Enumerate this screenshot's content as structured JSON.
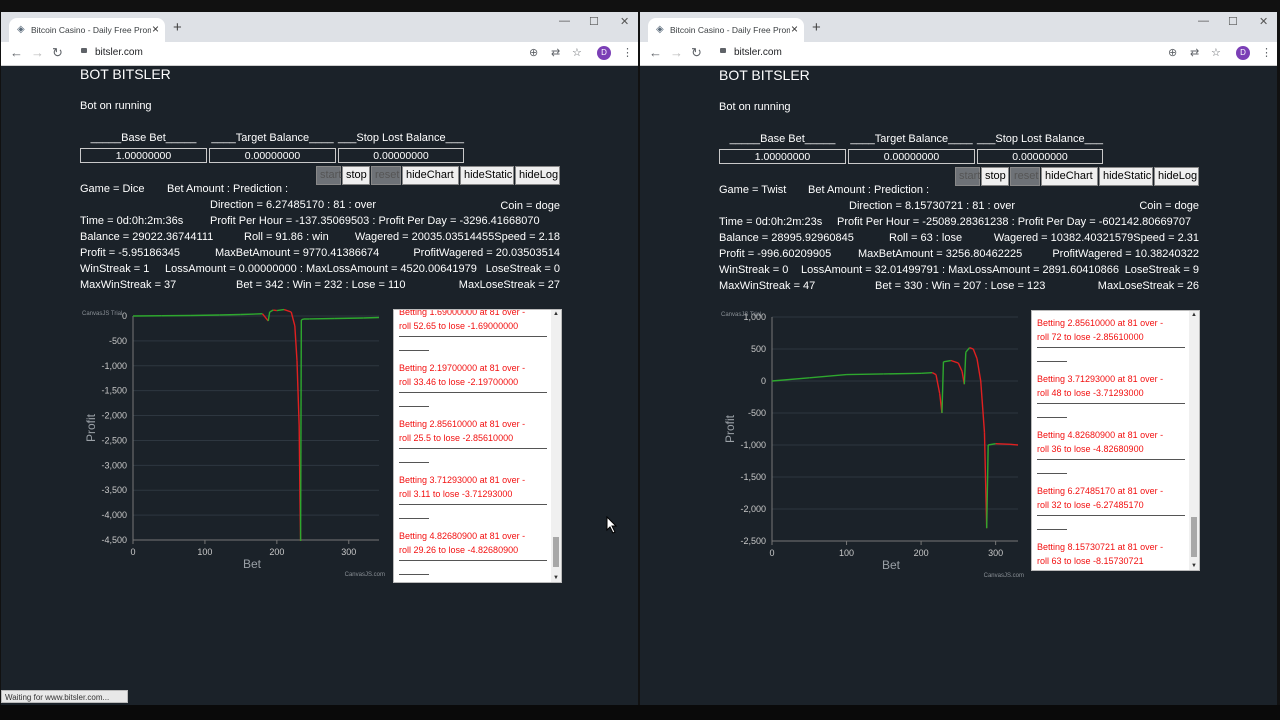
{
  "left": {
    "tab_title": "Bitcoin Casino - Daily Free Promo",
    "url": "bitsler.com",
    "avatar": "D",
    "bot_title": "BOT BITSLER",
    "bot_status": "Bot on running",
    "labels": {
      "base_bet": "_____Base Bet_____",
      "target_balance": "____Target Balance____",
      "stop_lost": "___Stop Lost Balance___"
    },
    "inputs": {
      "base_bet": "1.00000000",
      "target_balance": "0.00000000",
      "stop_lost": "0.00000000"
    },
    "buttons": {
      "start": "start",
      "stop": "stop",
      "reset": "reset",
      "hide_chart": "hideChart",
      "hide_static": "hideStatic",
      "hide_log": "hideLog"
    },
    "stats": {
      "game": "Game = Dice",
      "bet_amount": "Bet Amount : Prediction :",
      "direction": "Direction = 6.27485170 : 81 : over",
      "coin": "Coin = doge",
      "time": "Time = 0d:0h:2m:36s",
      "profit_rate": "Profit Per Hour = -137.35069503 : Profit Per Day = -3296.41668070",
      "balance": "Balance = 29022.36744111",
      "roll": "Roll = 91.86 : win",
      "wagered": "Wagered = 20035.03514455Speed = 2.18",
      "profit": "Profit = -5.95186345",
      "max_bet": "MaxBetAmount = 9770.41386674",
      "profit_wagered": "ProfitWagered = 20.03503514",
      "win_streak": "WinStreak = 1",
      "loss_amount": "LossAmount = 0.00000000 : MaxLossAmount = 4520.00641979",
      "lose_streak": "LoseStreak = 0",
      "max_win_streak": "MaxWinStreak = 37",
      "bet_count": "Bet = 342 : Win = 232 : Lose = 110",
      "max_lose_streak": "MaxLoseStreak = 27"
    },
    "chart_data": {
      "type": "line",
      "xlabel": "Bet",
      "ylabel": "Profit",
      "credit_top": "CanvasJS Trial",
      "credit_bottom": "CanvasJS.com",
      "xlim": [
        0,
        342
      ],
      "ylim": [
        -4500,
        0
      ],
      "xticks": [
        0,
        100,
        200,
        300
      ],
      "yticks": [
        0,
        -500,
        -1000,
        -1500,
        -2000,
        -2500,
        -3000,
        -3500,
        -4000,
        -4500
      ],
      "ytick_labels": [
        "0",
        "-500",
        "-1,000",
        "-1,500",
        "-2,000",
        "-2,500",
        "-3,000",
        "-3,500",
        "-4,000",
        "-4,500"
      ],
      "series": [
        {
          "x": [
            0,
            40,
            80,
            120,
            150,
            180,
            188,
            190,
            195,
            200,
            210,
            220,
            225,
            228,
            231,
            232,
            233,
            234,
            237,
            245,
            280,
            320,
            342
          ],
          "y": [
            0,
            5,
            10,
            20,
            30,
            45,
            -100,
            80,
            120,
            110,
            130,
            80,
            -200,
            -900,
            -2200,
            -3500,
            -4520,
            -80,
            -60,
            -60,
            -50,
            -40,
            -30
          ]
        }
      ]
    },
    "log": [
      {
        "a": "Betting 1.69000000 at 81 over -",
        "b": "roll 52.65 to lose -1.69000000"
      },
      {
        "a": "Betting 2.19700000 at 81 over -",
        "b": "roll 33.46 to lose -2.19700000"
      },
      {
        "a": "Betting 2.85610000 at 81 over -",
        "b": "roll 25.5 to lose -2.85610000"
      },
      {
        "a": "Betting 3.71293000 at 81 over -",
        "b": "roll 3.11 to lose -3.71293000"
      },
      {
        "a": "Betting 4.82680900 at 81 over -",
        "b": "roll 29.26 to lose -4.82680900"
      }
    ],
    "statusbar": "Waiting for www.bitsler.com..."
  },
  "right": {
    "tab_title": "Bitcoin Casino - Daily Free Promo",
    "url": "bitsler.com",
    "avatar": "D",
    "bot_title": "BOT BITSLER",
    "bot_status": "Bot on running",
    "labels": {
      "base_bet": "_____Base Bet_____",
      "target_balance": "____Target Balance____",
      "stop_lost": "___Stop Lost Balance___"
    },
    "inputs": {
      "base_bet": "1.00000000",
      "target_balance": "0.00000000",
      "stop_lost": "0.00000000"
    },
    "buttons": {
      "start": "start",
      "stop": "stop",
      "reset": "reset",
      "hide_chart": "hideChart",
      "hide_static": "hideStatic",
      "hide_log": "hideLog"
    },
    "stats": {
      "game": "Game = Twist",
      "bet_amount": "Bet Amount : Prediction :",
      "direction": "Direction = 8.15730721 : 81 : over",
      "coin": "Coin = doge",
      "time": "Time = 0d:0h:2m:23s",
      "profit_rate": "Profit Per Hour = -25089.28361238 : Profit Per Day = -602142.80669707",
      "balance": "Balance = 28995.92960845",
      "roll": "Roll = 63 : lose",
      "wagered": "Wagered = 10382.40321579Speed = 2.31",
      "profit": "Profit = -996.60209905",
      "max_bet": "MaxBetAmount = 3256.80462225",
      "profit_wagered": "ProfitWagered = 10.38240322",
      "win_streak": "WinStreak = 0",
      "loss_amount": "LossAmount = 32.01499791 : MaxLossAmount = 2891.60410866",
      "lose_streak": "LoseStreak = 9",
      "max_win_streak": "MaxWinStreak = 47",
      "bet_count": "Bet = 330 : Win = 207 : Lose = 123",
      "max_lose_streak": "MaxLoseStreak = 26"
    },
    "chart_data": {
      "type": "line",
      "xlabel": "Bet",
      "ylabel": "Profit",
      "credit_top": "CanvasJS Trial",
      "credit_bottom": "CanvasJS.com",
      "xlim": [
        0,
        330
      ],
      "ylim": [
        -2500,
        1000
      ],
      "xticks": [
        0,
        100,
        200,
        300
      ],
      "yticks": [
        1000,
        500,
        0,
        -500,
        -1000,
        -1500,
        -2000,
        -2500
      ],
      "ytick_labels": [
        "1,000",
        "500",
        "0",
        "-500",
        "-1,000",
        "-1,500",
        "-2,000",
        "-2,500"
      ],
      "series": [
        {
          "x": [
            0,
            50,
            100,
            150,
            200,
            215,
            220,
            225,
            228,
            230,
            240,
            250,
            255,
            258,
            260,
            265,
            270,
            275,
            280,
            285,
            288,
            290,
            300,
            320,
            330
          ],
          "y": [
            0,
            50,
            100,
            110,
            120,
            130,
            100,
            -200,
            -500,
            300,
            320,
            280,
            150,
            -50,
            450,
            520,
            500,
            350,
            0,
            -800,
            -2300,
            -1000,
            -980,
            -990,
            -1000
          ]
        }
      ]
    },
    "log": [
      {
        "a": "Betting 2.85610000 at 81 over -",
        "b": "roll 72 to lose -2.85610000"
      },
      {
        "a": "Betting 3.71293000 at 81 over -",
        "b": "roll 48 to lose -3.71293000"
      },
      {
        "a": "Betting 4.82680900 at 81 over -",
        "b": "roll 36 to lose -4.82680900"
      },
      {
        "a": "Betting 6.27485170 at 81 over -",
        "b": "roll 32 to lose -6.27485170"
      },
      {
        "a": "Betting 8.15730721 at 81 over -",
        "b": "roll 63 to lose -8.15730721"
      }
    ]
  }
}
